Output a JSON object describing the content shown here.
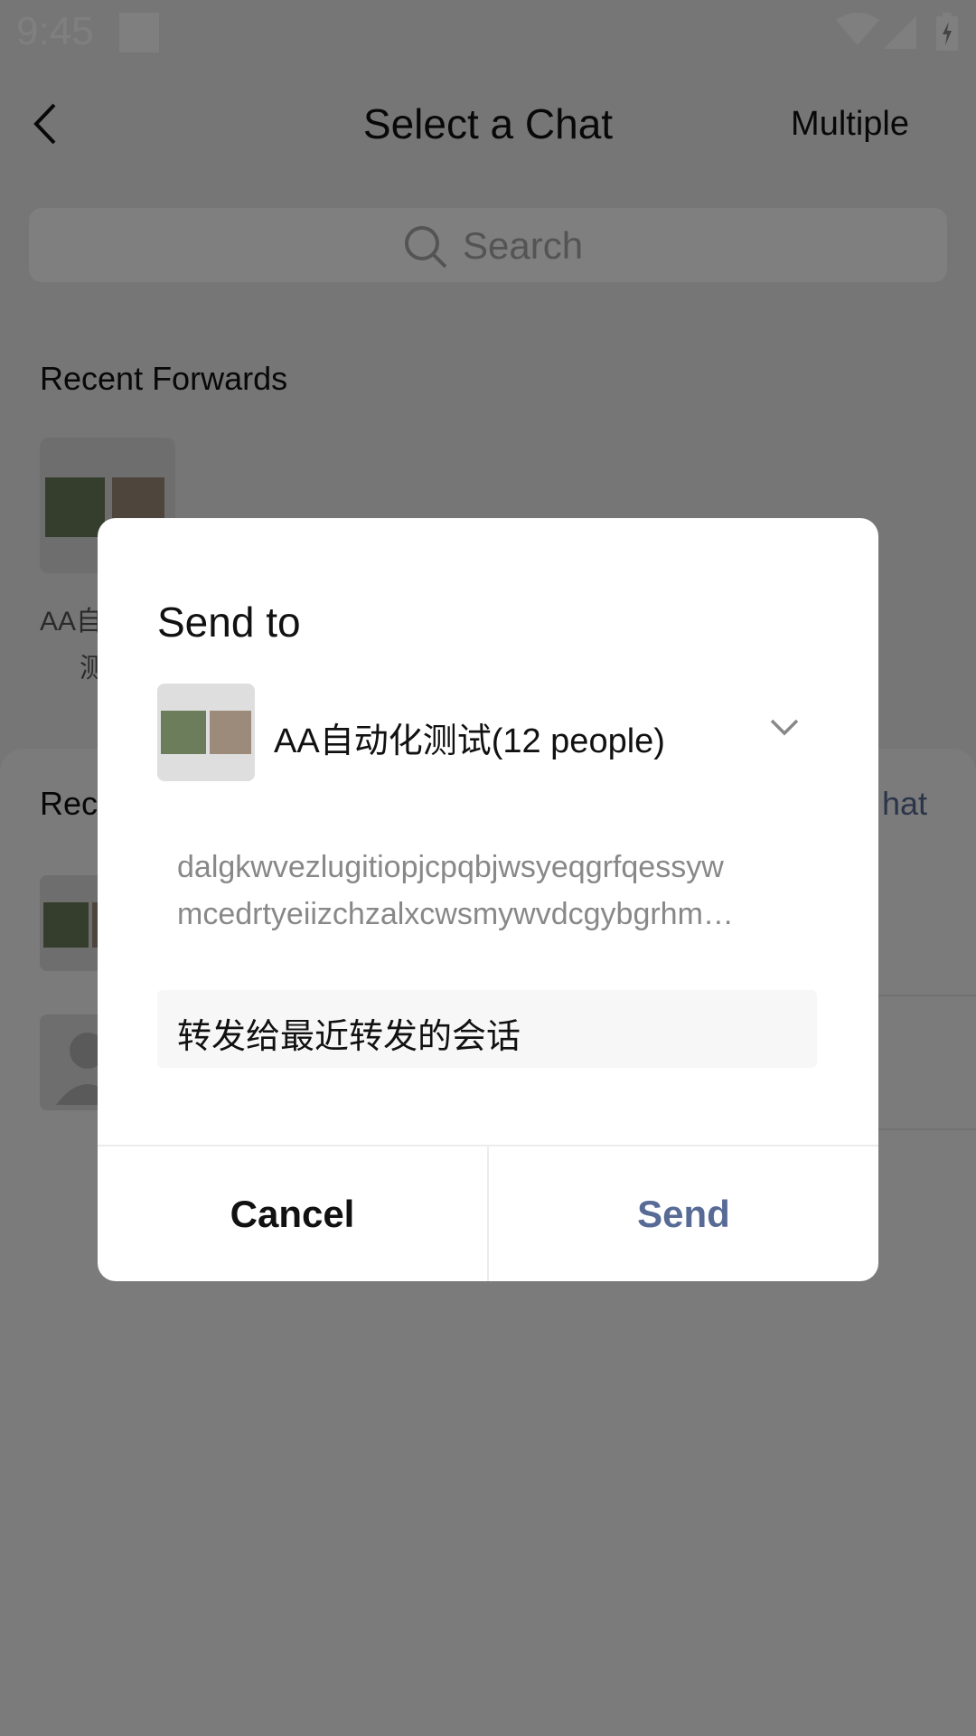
{
  "status_bar": {
    "time": "9:45"
  },
  "header": {
    "title": "Select a Chat",
    "multiple_label": "Multiple"
  },
  "search": {
    "placeholder": "Search"
  },
  "recent_forwards": {
    "title": "Recent Forwards",
    "item_label_line1": "AA自",
    "item_label_line2": "测"
  },
  "recent_chats": {
    "title_partial": "Rec",
    "link_partial": "hat"
  },
  "dialog": {
    "title": "Send to",
    "group_name": "AA自动化测试(12 people)",
    "message_line1": "dalgkwvezlugitiopjcpqbjwsyeqgrfqessyw",
    "message_line2": "mcedrtyeiizchzalxcwsmywvdcgybgrhm…",
    "input_value": "转发给最近转发的会话",
    "cancel_label": "Cancel",
    "send_label": "Send"
  },
  "colors": {
    "accent": "#576b95",
    "overlay": "rgba(0,0,0,0.5)"
  }
}
